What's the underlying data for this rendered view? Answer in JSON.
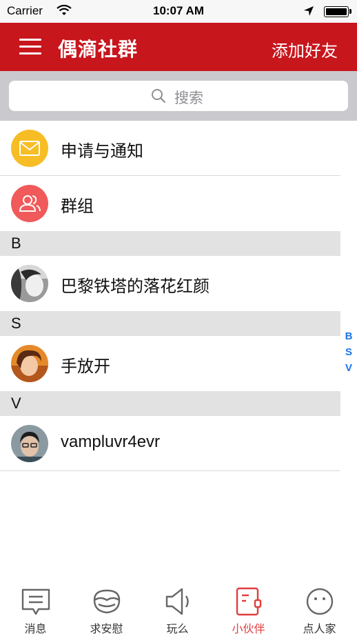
{
  "status_bar": {
    "carrier": "Carrier",
    "time": "10:07 AM"
  },
  "nav": {
    "title": "偶滴社群",
    "right_action": "添加好友"
  },
  "search": {
    "placeholder": "搜索"
  },
  "top_items": [
    {
      "label": "申请与通知",
      "icon": "envelope-icon",
      "color": "#f6bd25"
    },
    {
      "label": "群组",
      "icon": "group-icon",
      "color": "#f05a5a"
    }
  ],
  "sections": [
    {
      "header": "B",
      "contacts": [
        {
          "name": "巴黎铁塔的落花红颜"
        }
      ]
    },
    {
      "header": "S",
      "contacts": [
        {
          "name": "手放开"
        }
      ]
    },
    {
      "header": "V",
      "contacts": [
        {
          "name": "vampluvr4evr"
        }
      ]
    }
  ],
  "index": [
    "B",
    "S",
    "V"
  ],
  "tabs": [
    {
      "label": "消息",
      "icon": "message-icon",
      "active": false
    },
    {
      "label": "求安慰",
      "icon": "mask-icon",
      "active": false
    },
    {
      "label": "玩么",
      "icon": "speaker-icon",
      "active": false
    },
    {
      "label": "小伙伴",
      "icon": "contacts-book-icon",
      "active": true
    },
    {
      "label": "点人家",
      "icon": "smiley-icon",
      "active": false
    }
  ],
  "colors": {
    "nav_bg": "#c8161d",
    "accent": "#e03c3c",
    "index": "#1a73e8"
  }
}
